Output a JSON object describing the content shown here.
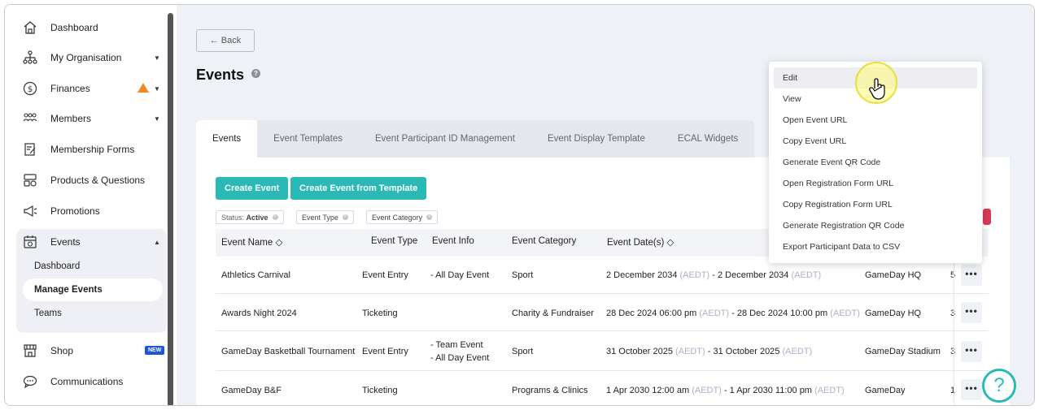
{
  "sidebar": {
    "items": [
      {
        "label": "Dashboard",
        "icon": "home-icon"
      },
      {
        "label": "My Organisation",
        "icon": "org-chart-icon"
      },
      {
        "label": "Finances",
        "icon": "dollar-icon"
      },
      {
        "label": "Members",
        "icon": "members-icon"
      },
      {
        "label": "Membership Forms",
        "icon": "form-icon"
      },
      {
        "label": "Products & Questions",
        "icon": "products-icon"
      },
      {
        "label": "Promotions",
        "icon": "megaphone-icon"
      },
      {
        "label": "Events",
        "icon": "calendar-icon"
      },
      {
        "label": "Shop",
        "icon": "shop-icon"
      },
      {
        "label": "Communications",
        "icon": "chat-icon"
      }
    ],
    "events_sub": [
      "Dashboard",
      "Manage Events",
      "Teams"
    ],
    "shop_badge": "NEW"
  },
  "main": {
    "back_label": "← Back",
    "title": "Events",
    "help_mark": "?",
    "tabs": [
      "Events",
      "Event Templates",
      "Event Participant ID Management",
      "Event Display Template",
      "ECAL Widgets"
    ],
    "buttons": {
      "create_event": "Create Event",
      "create_from_template": "Create Event from Template"
    },
    "filters": {
      "status_prefix": "Status:",
      "status_value": "Active",
      "event_type": "Event Type",
      "event_category": "Event Category"
    },
    "table": {
      "headers": [
        "Event Name ◇",
        "Event Type",
        "Event Info",
        "Event Category",
        "Event Date(s) ◇"
      ],
      "rows": [
        {
          "name": "Athletics Carnival",
          "type": "Event Entry",
          "info": [
            "- All Day Event"
          ],
          "category": "Sport",
          "d1": "2 December 2034",
          "t1": "(AEDT)",
          "sep": " - ",
          "d2": "2 December 2034",
          "t2": "(AEDT)",
          "venue": "GameDay HQ",
          "extra": "5"
        },
        {
          "name": "Awards Night 2024",
          "type": "Ticketing",
          "info": [],
          "category": "Charity & Fundraiser",
          "d1": "28 Dec 2024 06:00 pm",
          "t1": "(AEDT)",
          "sep": " - ",
          "d2": "28 Dec 2024 10:00 pm",
          "t2": "(AEDT)",
          "venue": "GameDay HQ",
          "extra": "3"
        },
        {
          "name": "GameDay Basketball Tournament",
          "type": "Event Entry",
          "info": [
            "- Team Event",
            "- All Day Event"
          ],
          "category": "Sport",
          "d1": "31 October 2025",
          "t1": "(AEDT)",
          "sep": " - ",
          "d2": "31 October 2025",
          "t2": "(AEDT)",
          "venue": "GameDay Stadium",
          "extra": "3"
        },
        {
          "name": "GameDay B&F",
          "type": "Ticketing",
          "info": [],
          "category": "Programs & Clinics",
          "d1": "1 Apr 2030 12:00 am",
          "t1": "(AEDT)",
          "sep": " - ",
          "d2": "1 Apr 2030 11:00 pm",
          "t2": "(AEDT)",
          "venue": "GameDay",
          "extra": "1"
        }
      ]
    },
    "more_label": "•••"
  },
  "menu": {
    "items": [
      "Edit",
      "View",
      "Open Event URL",
      "Copy Event URL",
      "Generate Event QR Code",
      "Open Registration Form URL",
      "Copy Registration Form URL",
      "Generate Registration QR Code",
      "Export Participant Data to CSV"
    ]
  },
  "help_fab": "?",
  "colors": {
    "teal": "#2bb9b6",
    "warning": "#f0891f",
    "new_badge": "#1f56d8",
    "danger": "#d83a52"
  }
}
